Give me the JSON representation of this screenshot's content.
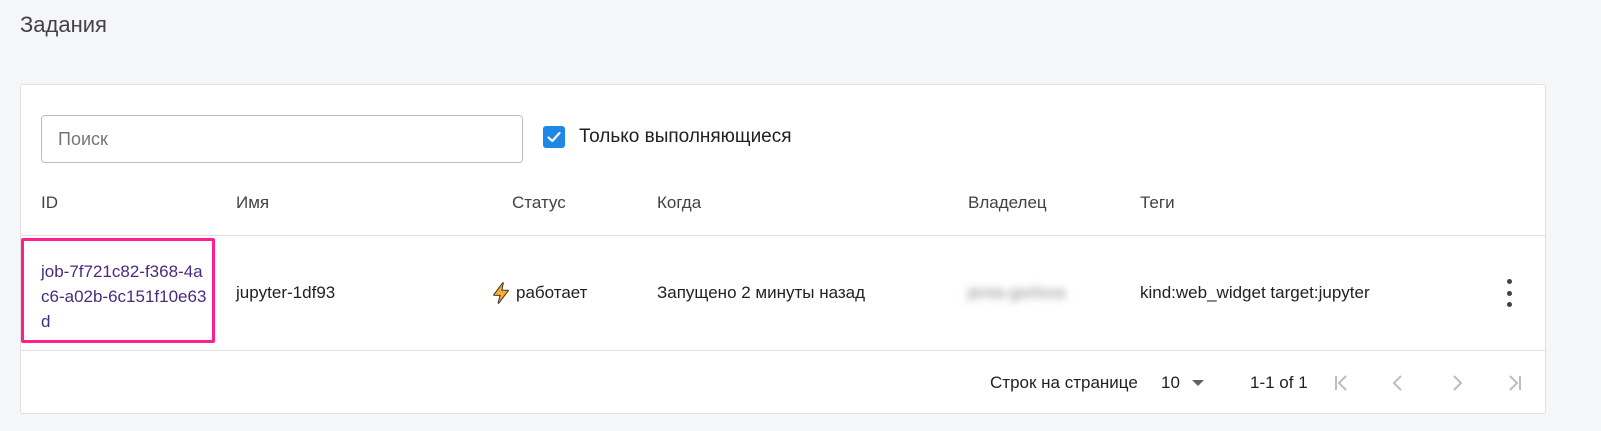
{
  "page": {
    "title": "Задания"
  },
  "filters": {
    "search_placeholder": "Поиск",
    "search_value": "",
    "running_only_label": "Только выполняющиеся",
    "running_only_checked": true
  },
  "table": {
    "columns": [
      "ID",
      "Имя",
      "Статус",
      "Когда",
      "Владелец",
      "Теги"
    ],
    "rows": [
      {
        "id": "job-7f721c82-f368-4ac6-a02b-6c151f10e63d",
        "name": "jupyter-1df93",
        "status": "работает",
        "status_icon": "lightning-icon",
        "when": "Запущено 2 минуты назад",
        "owner": "jenia-gorlova",
        "tags": "kind:web_widget target:jupyter"
      }
    ]
  },
  "pagination": {
    "rows_per_page_label": "Строк на странице",
    "rows_per_page_value": "10",
    "range_text": "1-1 of 1"
  },
  "colors": {
    "accent": "#1e88e5",
    "highlight": "#ff1f8e",
    "link": "#4a2a7f",
    "lightning": "#f9a825"
  }
}
